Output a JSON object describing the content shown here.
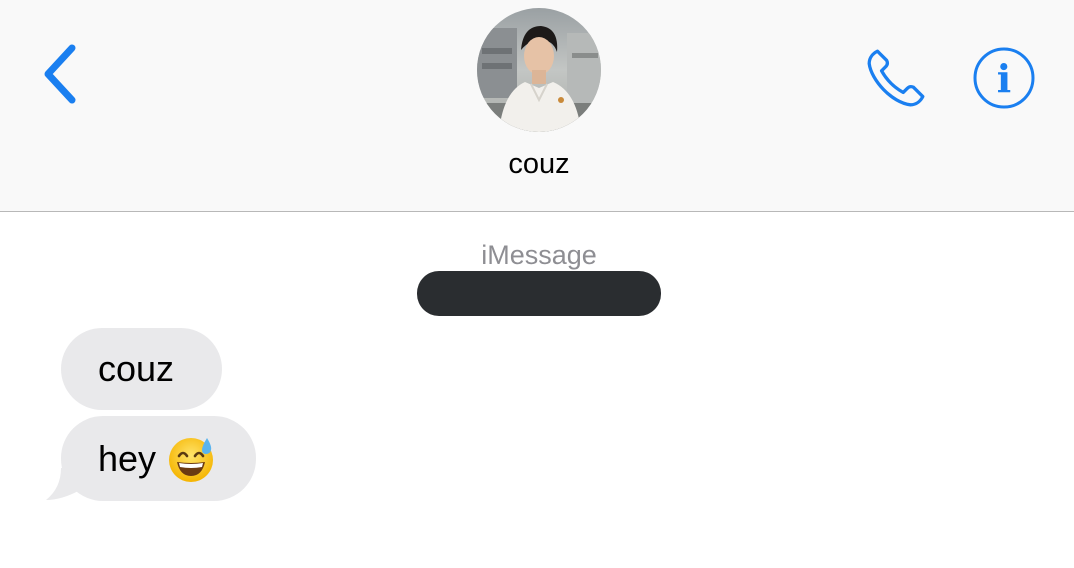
{
  "header": {
    "contact_name": "couz",
    "back_icon": "chevron-left-icon",
    "call_icon": "phone-icon",
    "info_icon": "info-icon",
    "accent_color": "#1a7ff0"
  },
  "conversation": {
    "service_label": "iMessage",
    "messages": [
      {
        "direction": "incoming",
        "text": "couz"
      },
      {
        "direction": "incoming",
        "text": "hey",
        "emoji": "grinning-face-with-sweat"
      }
    ]
  },
  "colors": {
    "header_bg": "#f9f9f9",
    "bubble_incoming": "#e9e9eb",
    "redaction": "#2a2d30",
    "service_label": "#8e8e93"
  }
}
